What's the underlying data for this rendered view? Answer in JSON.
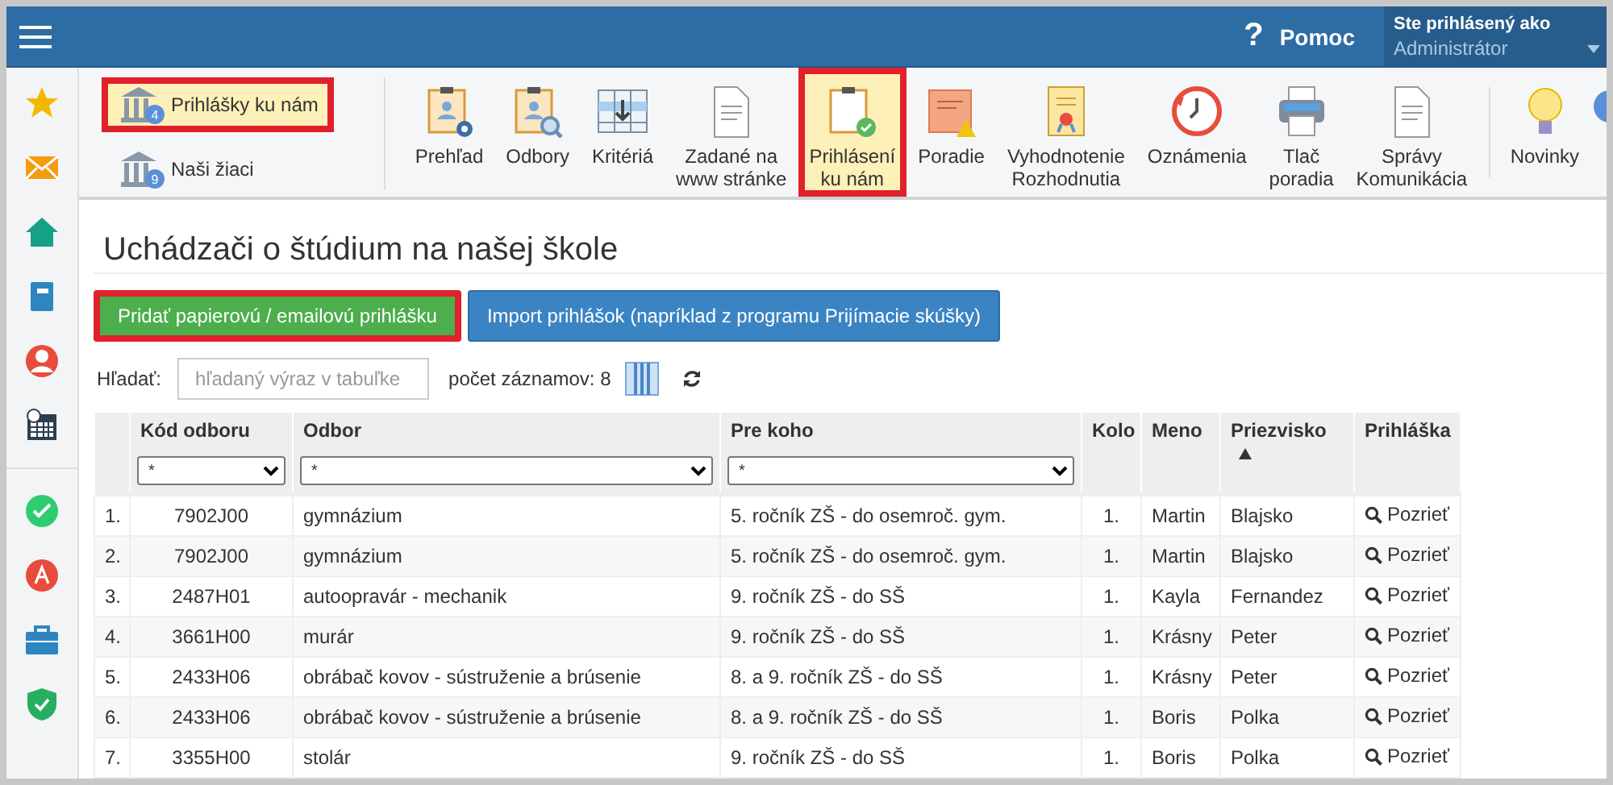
{
  "top_bar": {
    "help_mark": "?",
    "help": "Pomoc",
    "user_caption": "Ste prihlásený ako",
    "user_name": "Administrátor"
  },
  "sidebar": {
    "items": [
      {
        "selected": false
      },
      {
        "selected": false
      },
      {
        "selected": false
      },
      {
        "selected": false
      },
      {
        "selected": false
      },
      {
        "selected": false
      },
      {
        "selected": false
      },
      {
        "selected": false
      },
      {
        "selected": false
      },
      {
        "selected": false
      }
    ]
  },
  "toolbar": {
    "quick_links": [
      {
        "label": "Prihlášky ku nám",
        "badge": "4",
        "selected": true,
        "highlighted": true
      },
      {
        "label": "Naši žiaci",
        "badge": "9",
        "selected": false,
        "highlighted": false
      }
    ],
    "tools": [
      {
        "label": "Prehľad",
        "selected": false,
        "highlighted": false
      },
      {
        "label": "Odbory",
        "selected": false,
        "highlighted": false
      },
      {
        "label": "Kritériá",
        "selected": false,
        "highlighted": false
      },
      {
        "label": "Zadané na\nwww stránke",
        "selected": false,
        "highlighted": false
      },
      {
        "label": "Prihlásení\nku nám",
        "selected": true,
        "highlighted": true
      },
      {
        "label": "Poradie",
        "selected": false,
        "highlighted": false
      },
      {
        "label": "Vyhodnotenie\nRozhodnutia",
        "selected": false,
        "highlighted": false
      },
      {
        "label": "Oznámenia",
        "selected": false,
        "highlighted": false
      },
      {
        "label": "Tlač\nporadia",
        "selected": false,
        "highlighted": false
      },
      {
        "label": "Správy\nKomunikácia",
        "selected": false,
        "highlighted": false
      }
    ],
    "extra_tools": [
      {
        "label": "Novinky"
      }
    ]
  },
  "page_title": "Uchádzači o štúdium na našej škole",
  "actions": [
    {
      "label": "Pridať papierovú / emailovú prihlášku",
      "kind": "success",
      "highlighted": true
    },
    {
      "label": "Import prihlášok (napríklad z programu Prijímacie skúšky)",
      "kind": "primary",
      "highlighted": false
    }
  ],
  "search": {
    "label": "Hľadať:",
    "placeholder": "hľadaný výraz v tabuľke",
    "count": "počet záznamov: 8"
  },
  "table": {
    "columns": [
      {
        "label": "Kód odboru",
        "filter": "*",
        "sorted": false
      },
      {
        "label": "Odbor",
        "filter": "*",
        "sorted": false
      },
      {
        "label": "Pre koho",
        "filter": "*",
        "sorted": false
      },
      {
        "label": "Kolo",
        "sorted": false
      },
      {
        "label": "Meno",
        "sorted": false
      },
      {
        "label": "Priezvisko",
        "sorted": true
      },
      {
        "label": "Prihláška",
        "sorted": false
      }
    ],
    "rows": [
      {
        "num": "1.",
        "code": "7902J00",
        "field": "gymnázium",
        "target": "5. ročník ZŠ - do osemroč. gym.",
        "round": "1.",
        "first": "Martin",
        "last": "Blajsko",
        "link": "Pozrieť"
      },
      {
        "num": "2.",
        "code": "7902J00",
        "field": "gymnázium",
        "target": "5. ročník ZŠ - do osemroč. gym.",
        "round": "1.",
        "first": "Martin",
        "last": "Blajsko",
        "link": "Pozrieť"
      },
      {
        "num": "3.",
        "code": "2487H01",
        "field": "autoopravár - mechanik",
        "target": "9. ročník ZŠ - do SŠ",
        "round": "1.",
        "first": "Kayla",
        "last": "Fernandez",
        "link": "Pozrieť"
      },
      {
        "num": "4.",
        "code": "3661H00",
        "field": "murár",
        "target": "9. ročník ZŠ - do SŠ",
        "round": "1.",
        "first": "Krásny",
        "last": "Peter",
        "link": "Pozrieť"
      },
      {
        "num": "5.",
        "code": "2433H06",
        "field": "obrábač kovov - sústruženie a brúsenie",
        "target": "8. a 9. ročník ZŠ - do SŠ",
        "round": "1.",
        "first": "Krásny",
        "last": "Peter",
        "link": "Pozrieť"
      },
      {
        "num": "6.",
        "code": "2433H06",
        "field": "obrábač kovov - sústruženie a brúsenie",
        "target": "8. a 9. ročník ZŠ - do SŠ",
        "round": "1.",
        "first": "Boris",
        "last": "Polka",
        "link": "Pozrieť"
      },
      {
        "num": "7.",
        "code": "3355H00",
        "field": "stolár",
        "target": "9. ročník ZŠ - do SŠ",
        "round": "1.",
        "first": "Boris",
        "last": "Polka",
        "link": "Pozrieť"
      }
    ]
  }
}
